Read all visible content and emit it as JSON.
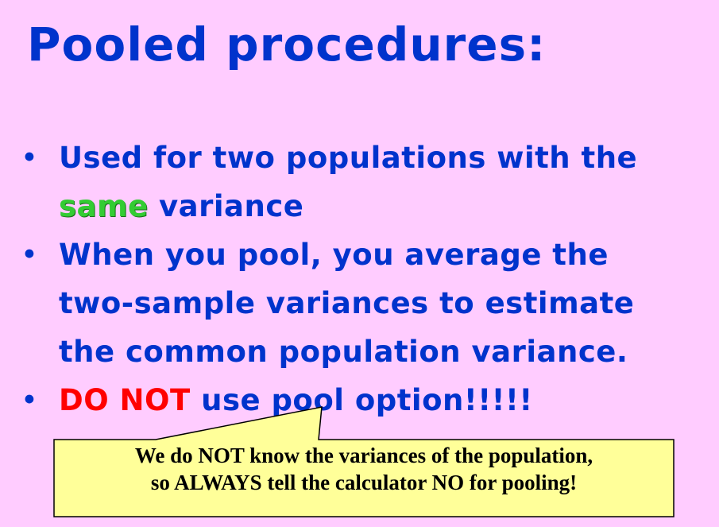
{
  "title": "Pooled procedures:",
  "bullets": [
    {
      "line1": "Used for two populations with the",
      "emphasis": "same",
      "rest": " variance"
    },
    {
      "line1": "When you pool, you average the",
      "line2": "two-sample variances to estimate",
      "line3": "the common population variance."
    },
    {
      "emphasis": "DO NOT",
      "rest": " use pool option!!!!!"
    }
  ],
  "bullet_symbol": "•",
  "callout": {
    "line1": "We do NOT know the variances of the population,",
    "line2": "so ALWAYS tell the calculator NO for pooling!"
  },
  "colors": {
    "background": "#ffccff",
    "heading": "#0033cc",
    "same_highlight": "#33cc33",
    "warning": "#ff0000",
    "callout_fill": "#ffff99"
  }
}
